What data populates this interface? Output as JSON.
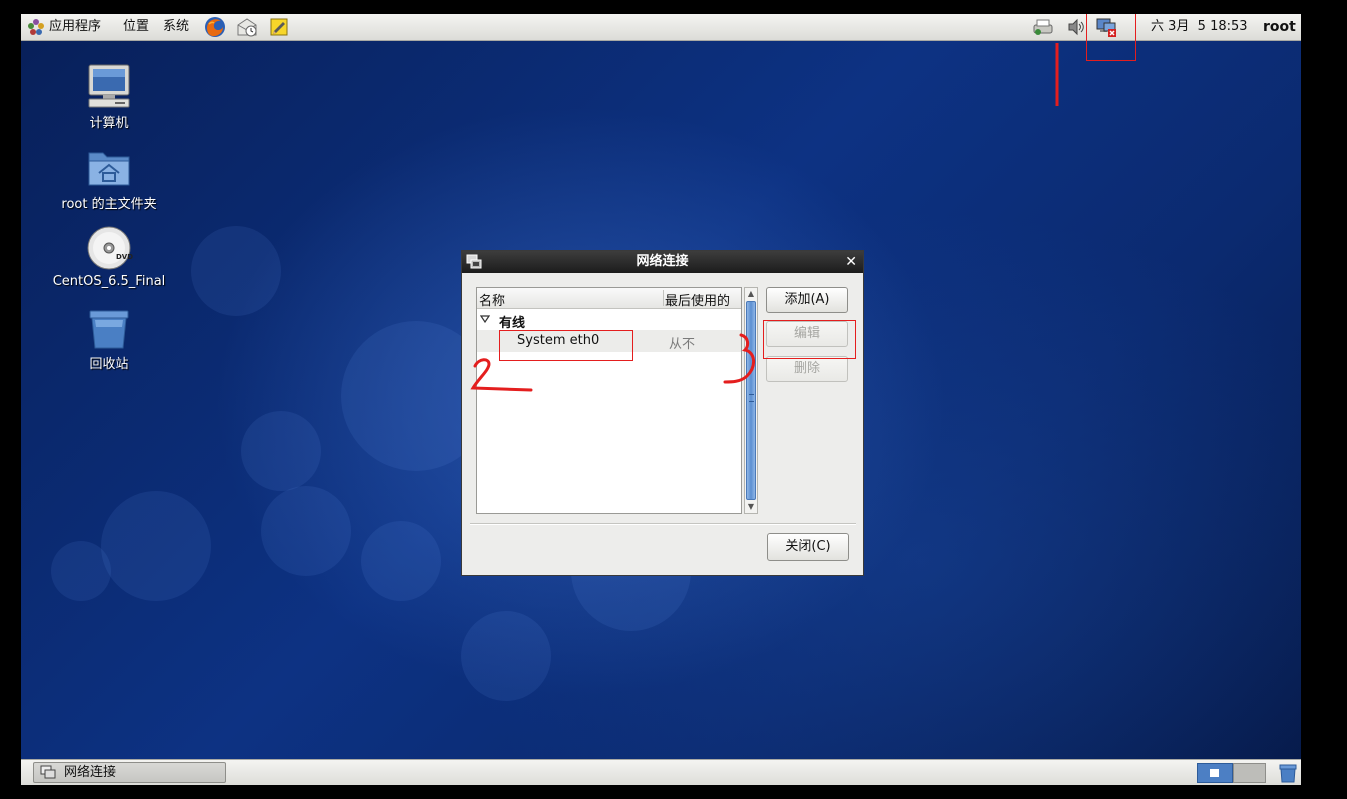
{
  "top_panel": {
    "apps_menu": "应用程序",
    "places_menu": "位置",
    "system_menu": "系统",
    "launchers": [
      "firefox-icon",
      "mail-clock-icon",
      "notes-icon"
    ],
    "tray_icons": [
      "printer-icon",
      "volume-icon",
      "network-disconnected-icon"
    ],
    "clock": "六 3月  5 18:53",
    "user": "root"
  },
  "desktop": {
    "icons": [
      {
        "label": "计算机",
        "icon": "computer-icon"
      },
      {
        "label": "root 的主文件夹",
        "icon": "home-folder-icon"
      },
      {
        "label": "CentOS_6.5_Final",
        "icon": "dvd-icon"
      },
      {
        "label": "回收站",
        "icon": "trash-icon"
      }
    ],
    "background_color": "#0d3283"
  },
  "window": {
    "title": "网络连接",
    "columns": {
      "name": "名称",
      "last_used": "最后使用的"
    },
    "group": "有线",
    "connection": {
      "name": "System eth0",
      "last_used": "从不"
    },
    "buttons": {
      "add": "添加(A)",
      "edit": "编辑",
      "delete": "删除",
      "close": "关闭(C)"
    }
  },
  "annotations": {
    "color": "#e41e1e",
    "marks": [
      "2",
      "3"
    ]
  },
  "bottom_panel": {
    "task_label": "网络连接"
  }
}
